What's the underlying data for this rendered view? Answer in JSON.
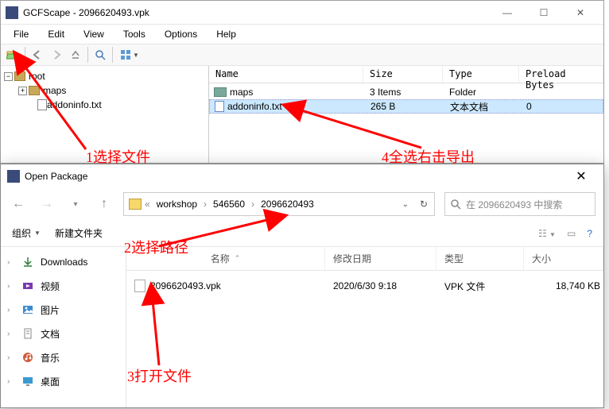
{
  "gcf": {
    "title": "GCFScape - 2096620493.vpk",
    "menu": {
      "file": "File",
      "edit": "Edit",
      "view": "View",
      "tools": "Tools",
      "options": "Options",
      "help": "Help"
    },
    "tree": {
      "root": "root",
      "maps": "maps",
      "addoninfo": "addoninfo.txt"
    },
    "list": {
      "cols": {
        "name": "Name",
        "size": "Size",
        "type": "Type",
        "preload": "Preload Bytes"
      },
      "rows": [
        {
          "name": "maps",
          "size": "3 Items",
          "type": "Folder",
          "preload": "",
          "kind": "folder"
        },
        {
          "name": "addoninfo.txt",
          "size": "265 B",
          "type": "文本文档",
          "preload": "0",
          "kind": "file"
        }
      ]
    }
  },
  "dlg": {
    "title": "Open Package",
    "path": {
      "workshop": "workshop",
      "p2": "546560",
      "p3": "2096620493"
    },
    "search_placeholder": "在 2096620493 中搜索",
    "toolbar": {
      "org": "组织",
      "newfolder": "新建文件夹"
    },
    "side": {
      "downloads": "Downloads",
      "video": "视频",
      "pictures": "图片",
      "documents": "文档",
      "music": "音乐",
      "desktop": "桌面"
    },
    "cols": {
      "name": "名称",
      "date": "修改日期",
      "type": "类型",
      "size": "大小"
    },
    "rows": [
      {
        "name": "2096620493.vpk",
        "date": "2020/6/30 9:18",
        "type": "VPK 文件",
        "size": "18,740 KB"
      }
    ]
  },
  "annotations": {
    "a1": "1选择文件",
    "a2": "2选择路径",
    "a3": "3打开文件",
    "a4": "4全选右击导出"
  }
}
